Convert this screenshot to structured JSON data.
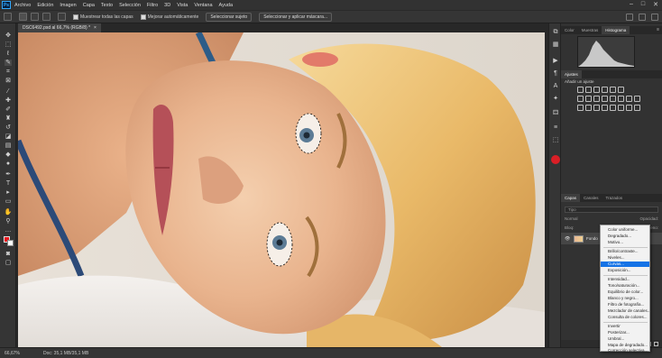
{
  "menubar": {
    "logo": "Ps",
    "items": [
      "Archivo",
      "Edición",
      "Imagen",
      "Capa",
      "Texto",
      "Selección",
      "Filtro",
      "3D",
      "Vista",
      "Ventana",
      "Ayuda"
    ],
    "window_controls": [
      "–",
      "□",
      "✕"
    ]
  },
  "options": {
    "sample_all_layers": "Muestrear todas las capas",
    "auto_enhance": "Mejorar automáticamente",
    "select_subject": "Seleccionar sujeto",
    "select_and_mask": "Seleccionar y aplicar máscara..."
  },
  "document": {
    "tab_label": "DSC6492.psd al 66,7% (RGB/8) *",
    "tab_close": "×"
  },
  "status": {
    "zoom": "66,67%",
    "doc_info": "Doc: 35,1 MB/35,1 MB"
  },
  "panels": {
    "top_tabs": [
      "Color",
      "Muestras",
      "Histograma"
    ],
    "top_active": "Histograma",
    "adj_tabs": [
      "Ajustes"
    ],
    "adj_label": "Añadir un ajuste",
    "layer_tabs": [
      "Capas",
      "Canales",
      "Trazados"
    ],
    "layer_active": "Capas",
    "search_placeholder": "Tipo",
    "blend_mode": "Normal",
    "opacity_label": "Opacidad:",
    "lock_label": "Bloq:",
    "fill_label": "Relleno:",
    "layer_name": "Fondo",
    "eye_icon": "👁"
  },
  "dropdown": {
    "items": [
      "Color uniforme...",
      "Degradado...",
      "Motivo...",
      "Brillo/contraste...",
      "Niveles...",
      "Curvas...",
      "Exposición...",
      "Intensidad...",
      "Tono/saturación...",
      "Equilibrio de color...",
      "Blanco y negro...",
      "Filtro de fotografía...",
      "Mezclador de canales...",
      "Consulta de colores...",
      "Invertir",
      "Posterizar...",
      "Umbral...",
      "Mapa de degradado...",
      "Corrección selectiva..."
    ],
    "highlighted": "Curvas..."
  },
  "colors": {
    "foreground": "#e8141c",
    "background": "#ffffff",
    "highlight": "#1473e6"
  }
}
